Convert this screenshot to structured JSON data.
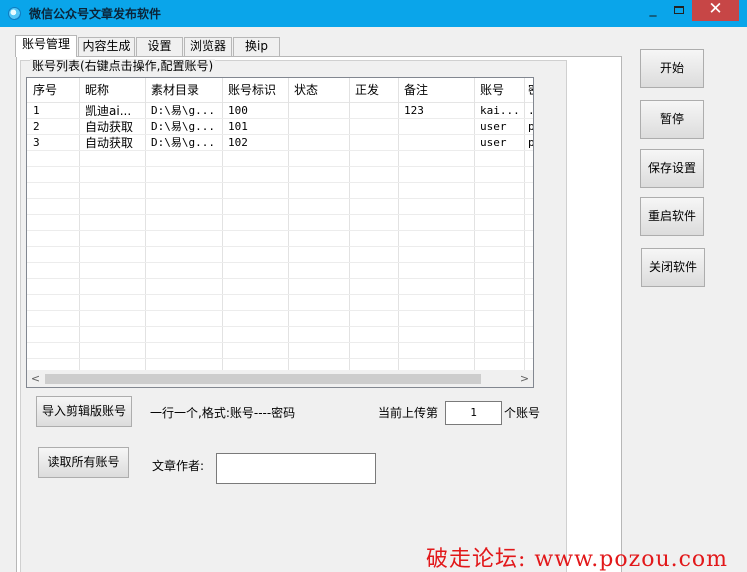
{
  "window": {
    "title": "微信公众号文章发布软件",
    "minimize_glyph": "_",
    "close_glyph": "✕"
  },
  "tabs": [
    {
      "label": "账号管理",
      "active": true
    },
    {
      "label": "内容生成"
    },
    {
      "label": "设置"
    },
    {
      "label": "浏览器"
    },
    {
      "label": "换ip"
    }
  ],
  "account_group": {
    "title": "账号列表(右键点击操作,配置账号)",
    "columns": [
      "序号",
      "昵称",
      "素材目录",
      "账号标识",
      "状态",
      "正发",
      "备注",
      "账号",
      "密"
    ],
    "rows": [
      [
        "1",
        "凯迪ai...",
        "D:\\易\\g...",
        "100",
        "",
        "",
        "123",
        "kai...",
        "."
      ],
      [
        "2",
        "自动获取",
        "D:\\易\\g...",
        "101",
        "",
        "",
        "",
        "user",
        "p"
      ],
      [
        "3",
        "自动获取",
        "D:\\易\\g...",
        "102",
        "",
        "",
        "",
        "user",
        "p"
      ]
    ]
  },
  "import_button": "导入剪辑版账号",
  "format_hint": "一行一个,格式:账号----密码",
  "upload_label_before": "当前上传第",
  "upload_index": "1",
  "upload_label_after": "个账号",
  "read_accounts_button": "读取所有账号",
  "author_label": "文章作者:",
  "author_value": "",
  "side_buttons": {
    "start": "开始",
    "pause": "暂停",
    "save": "保存设置",
    "restart": "重启软件",
    "close_app": "关闭软件"
  },
  "scrollbar": {
    "left_arrow": "<",
    "right_arrow": ">"
  },
  "watermark": "破走论坛: www.pozou.com",
  "icons": {
    "app": "app-circle-icon",
    "minimize": "minimize-icon",
    "maximize": "maximize-icon",
    "close": "close-icon"
  }
}
